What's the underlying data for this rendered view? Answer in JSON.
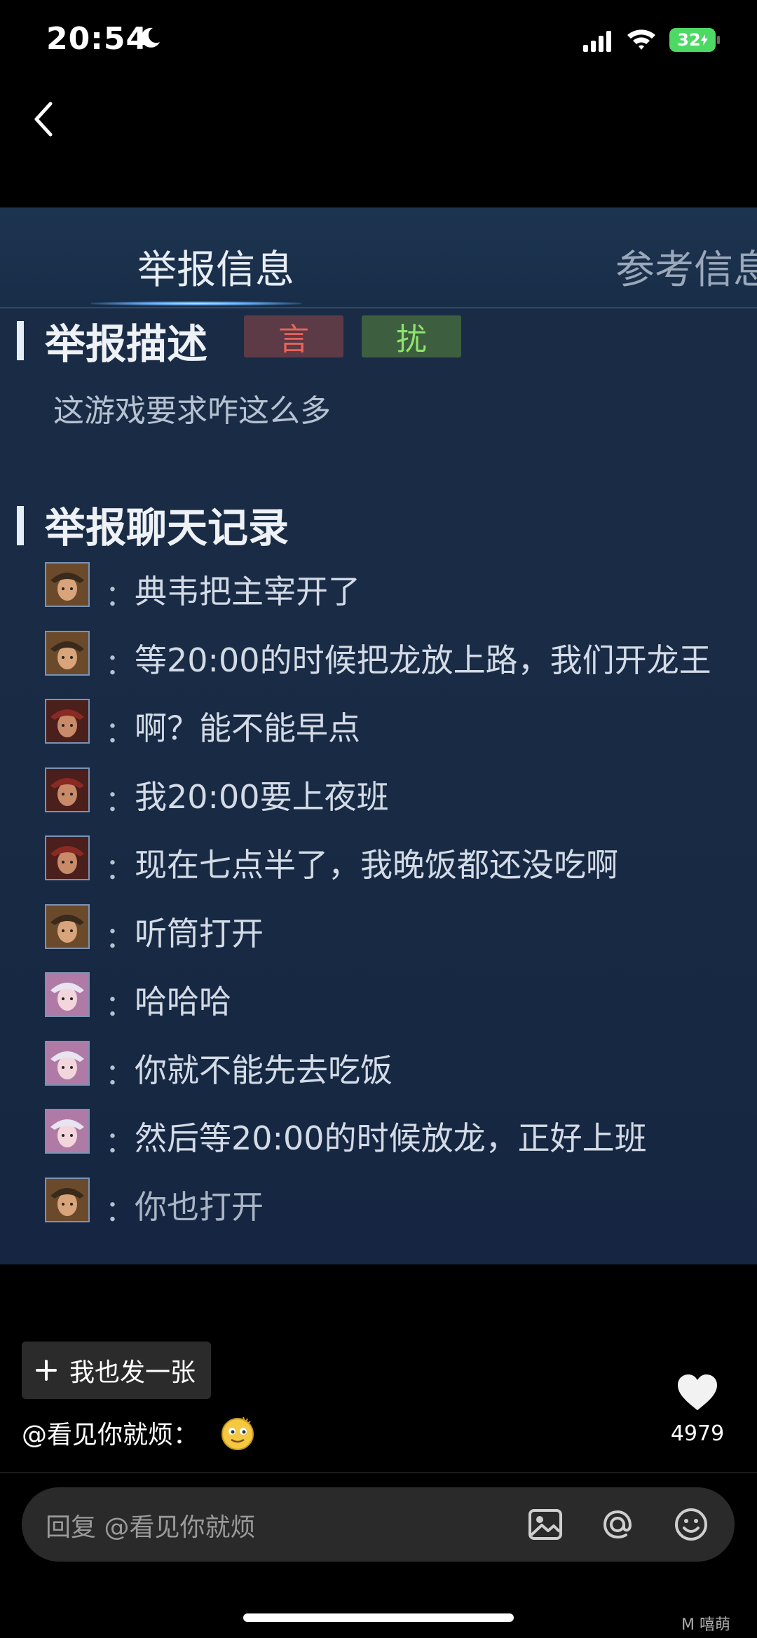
{
  "status_bar": {
    "time": "20:54",
    "battery": "32"
  },
  "shot": {
    "tabs": [
      "举报信息",
      "参考信息"
    ],
    "report_desc_title": "举报描述",
    "badges": [
      "言",
      "扰"
    ],
    "report_desc_text": "这游戏要求咋这么多",
    "chat_title": "举报聊天记录",
    "colon": "：",
    "chat": [
      {
        "avatar": "hero-a",
        "text": "典韦把主宰开了"
      },
      {
        "avatar": "hero-a",
        "text": "等20:00的时候把龙放上路，我们开龙王"
      },
      {
        "avatar": "hero-b",
        "text": "啊？能不能早点"
      },
      {
        "avatar": "hero-b",
        "text": "我20:00要上夜班"
      },
      {
        "avatar": "hero-b",
        "text": "现在七点半了，我晚饭都还没吃啊"
      },
      {
        "avatar": "hero-a",
        "text": "听筒打开"
      },
      {
        "avatar": "hero-c",
        "text": "哈哈哈"
      },
      {
        "avatar": "hero-c",
        "text": "你就不能先去吃饭"
      },
      {
        "avatar": "hero-c",
        "text": "然后等20:00的时候放龙，正好上班"
      },
      {
        "avatar": "hero-a",
        "text": "你也打开"
      }
    ]
  },
  "post_button": {
    "label": "我也发一张"
  },
  "caption": {
    "text": "@看见你就烦："
  },
  "likes": {
    "count": "4979"
  },
  "reply": {
    "placeholder": "回复 @看见你就烦"
  },
  "watermark": "M  嘻萌"
}
